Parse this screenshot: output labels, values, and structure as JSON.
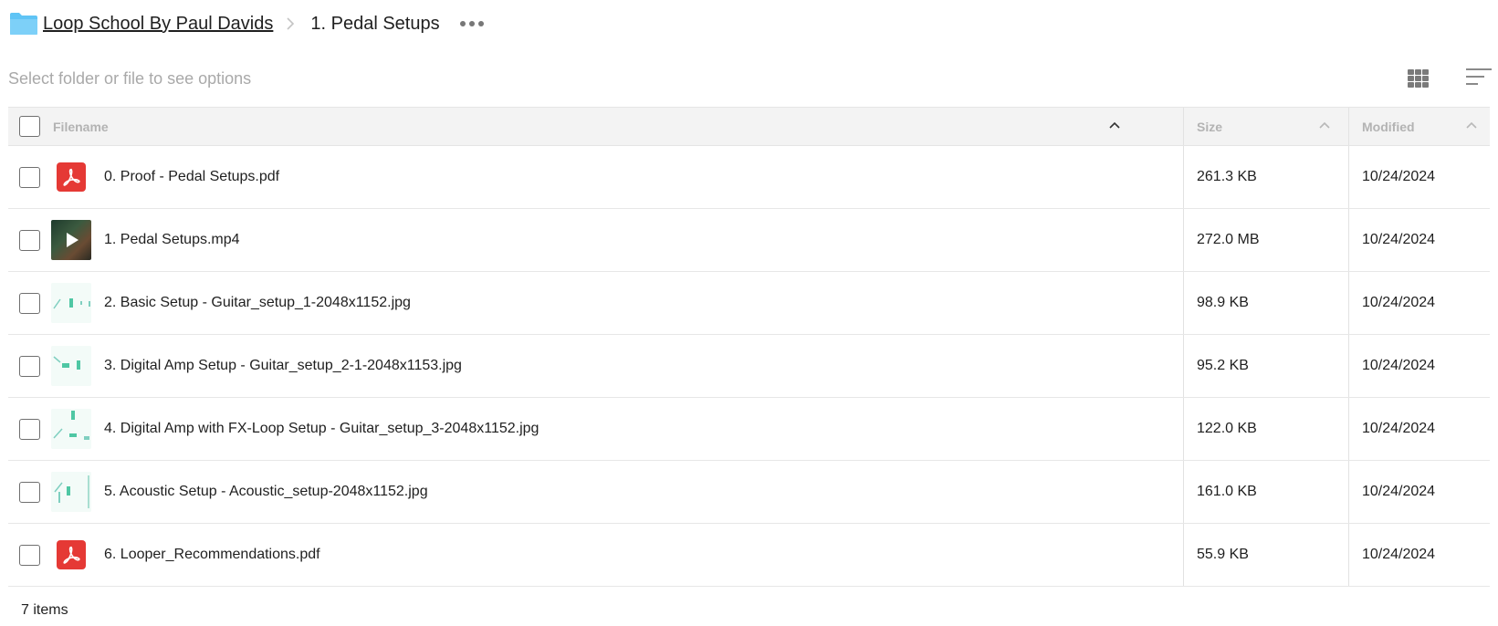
{
  "breadcrumb": {
    "root": "Loop School By Paul Davids",
    "current": "1. Pedal Setups"
  },
  "toolbar": {
    "hint": "Select folder or file to see options"
  },
  "table": {
    "headers": {
      "filename": "Filename",
      "size": "Size",
      "modified": "Modified"
    },
    "rows": [
      {
        "icon": "pdf-icon",
        "name": "0. Proof - Pedal Setups.pdf",
        "size": "261.3 KB",
        "modified": "10/24/2024"
      },
      {
        "icon": "video-thumbnail",
        "name": "1. Pedal Setups.mp4",
        "size": "272.0 MB",
        "modified": "10/24/2024"
      },
      {
        "icon": "image-thumbnail",
        "name": "2. Basic Setup - Guitar_setup_1-2048x1152.jpg",
        "size": "98.9 KB",
        "modified": "10/24/2024"
      },
      {
        "icon": "image-thumbnail",
        "name": "3. Digital Amp Setup - Guitar_setup_2-1-2048x1153.jpg",
        "size": "95.2 KB",
        "modified": "10/24/2024"
      },
      {
        "icon": "image-thumbnail",
        "name": "4. Digital Amp with FX-Loop Setup - Guitar_setup_3-2048x1152.jpg",
        "size": "122.0 KB",
        "modified": "10/24/2024"
      },
      {
        "icon": "image-thumbnail",
        "name": "5. Acoustic Setup - Acoustic_setup-2048x1152.jpg",
        "size": "161.0 KB",
        "modified": "10/24/2024"
      },
      {
        "icon": "pdf-icon",
        "name": "6. Looper_Recommendations.pdf",
        "size": "55.9 KB",
        "modified": "10/24/2024"
      }
    ]
  },
  "footer": {
    "count": "7 items"
  },
  "colors": {
    "folder": "#5fc4f5",
    "pdf": "#e53935",
    "header_bg": "#f3f3f3",
    "hint_text": "#a9a9a9"
  }
}
